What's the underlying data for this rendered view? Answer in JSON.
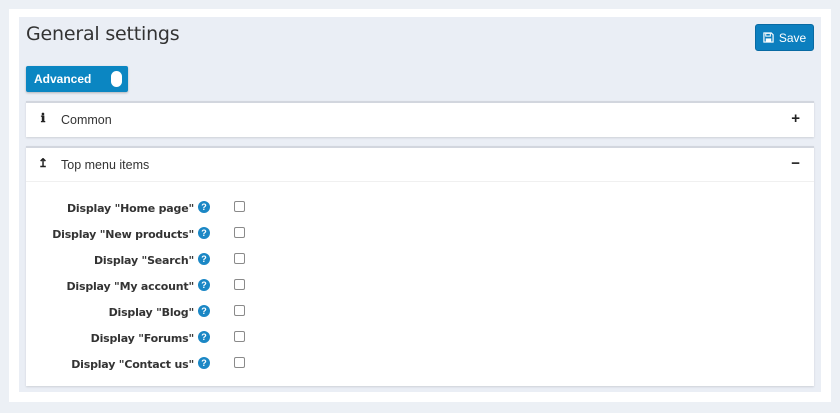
{
  "header": {
    "title": "General settings",
    "save_label": "Save"
  },
  "advanced": {
    "label": "Advanced"
  },
  "panels": {
    "common": {
      "title": "Common",
      "icon": "info-icon",
      "toggle": "+"
    },
    "top_menu": {
      "title": "Top menu items",
      "icon": "arrow-up-icon",
      "toggle": "−",
      "items": [
        {
          "label": "Display \"Home page\"",
          "checked": false
        },
        {
          "label": "Display \"New products\"",
          "checked": false
        },
        {
          "label": "Display \"Search\"",
          "checked": false
        },
        {
          "label": "Display \"My account\"",
          "checked": false
        },
        {
          "label": "Display \"Blog\"",
          "checked": false
        },
        {
          "label": "Display \"Forums\"",
          "checked": false
        },
        {
          "label": "Display \"Contact us\"",
          "checked": false
        }
      ]
    }
  },
  "colors": {
    "accent": "#0c7fbf",
    "background": "#eaeef5",
    "help": "#1b87c5"
  }
}
